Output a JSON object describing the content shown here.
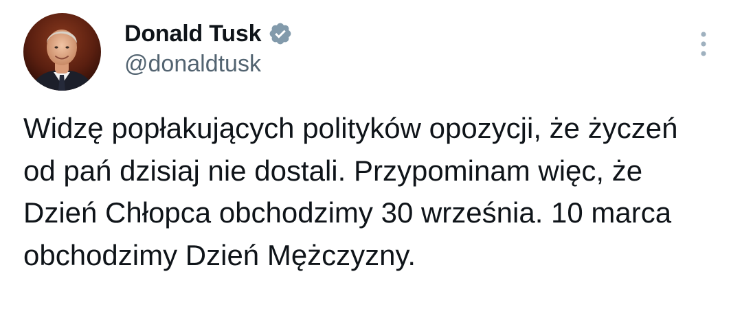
{
  "author": {
    "display_name": "Donald Tusk",
    "handle": "@donaldtusk",
    "avatar_icon": "profile-photo",
    "verified_icon": "verified-badge-icon"
  },
  "menu": {
    "icon": "more-vertical-icon"
  },
  "tweet": {
    "text": "Widzę popłakujących polityków opozycji, że życzeń od pań dzisiaj nie dostali. Przypominam więc, że Dzień Chłopca obchodzimy 30 września. 10 marca obchodzimy Dzień Mężczyzny."
  },
  "colors": {
    "text": "#0f1419",
    "secondary": "#536471",
    "badge": "#829aab",
    "menu_dots": "#9fb1bf",
    "background": "#ffffff"
  }
}
